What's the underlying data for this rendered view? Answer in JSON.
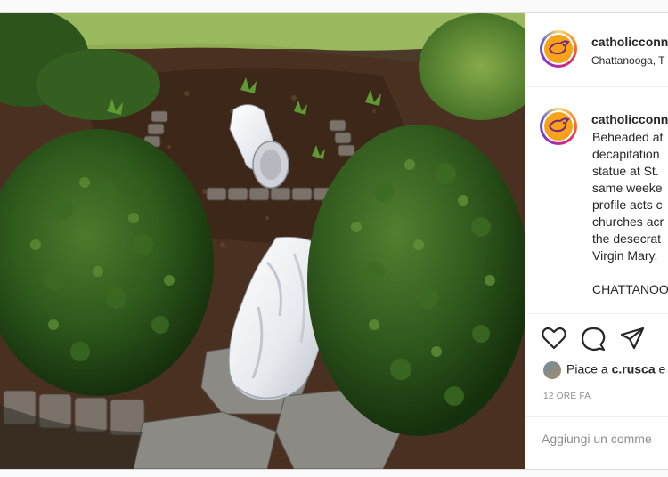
{
  "post": {
    "account": {
      "username": "catholicconn",
      "location": "Chattanooga, T",
      "avatar_icon": "dove-icon",
      "avatar_color": "#f7a21b"
    },
    "caption": {
      "username": "catholicconn",
      "lines": [
        "Beheaded at",
        "decapitation",
        "statue at St.",
        "same weeke",
        "profile acts c",
        "churches acr",
        "the desecrat",
        "Virgin Mary.",
        "",
        "CHATTANOO"
      ]
    },
    "actions": {
      "like_icon": "heart-icon",
      "comment_icon": "speech-bubble-icon",
      "share_icon": "paper-plane-icon"
    },
    "likes": {
      "prefix": "Piace a",
      "user": "c.rusca",
      "suffix": "e"
    },
    "timestamp": "12 ORE FA",
    "comment_box": {
      "placeholder": "Aggiungi un comme"
    }
  }
}
